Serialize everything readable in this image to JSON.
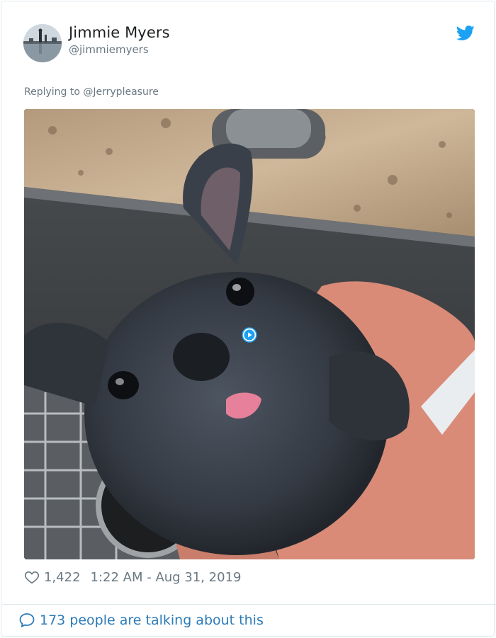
{
  "tweet": {
    "author": {
      "display_name": "Jimmie Myers",
      "handle": "@jimmiemyers",
      "avatar_icon": "avatar-photo"
    },
    "brand_icon": "twitter-bird-icon",
    "reply": {
      "prefix": "Replying to",
      "mention": "@Jerrypleasure"
    },
    "media": {
      "type": "video",
      "play_icon": "play-icon"
    },
    "meta": {
      "like_icon": "heart-icon",
      "likes": "1,422",
      "timestamp": "1:22 AM - Aug 31, 2019"
    },
    "footer": {
      "icon": "speech-bubble-icon",
      "talking": "173 people are talking about this"
    }
  },
  "colors": {
    "brand": "#1da1f2",
    "link": "#2b7bb9",
    "muted": "#697882",
    "border": "#e1e8ed"
  }
}
